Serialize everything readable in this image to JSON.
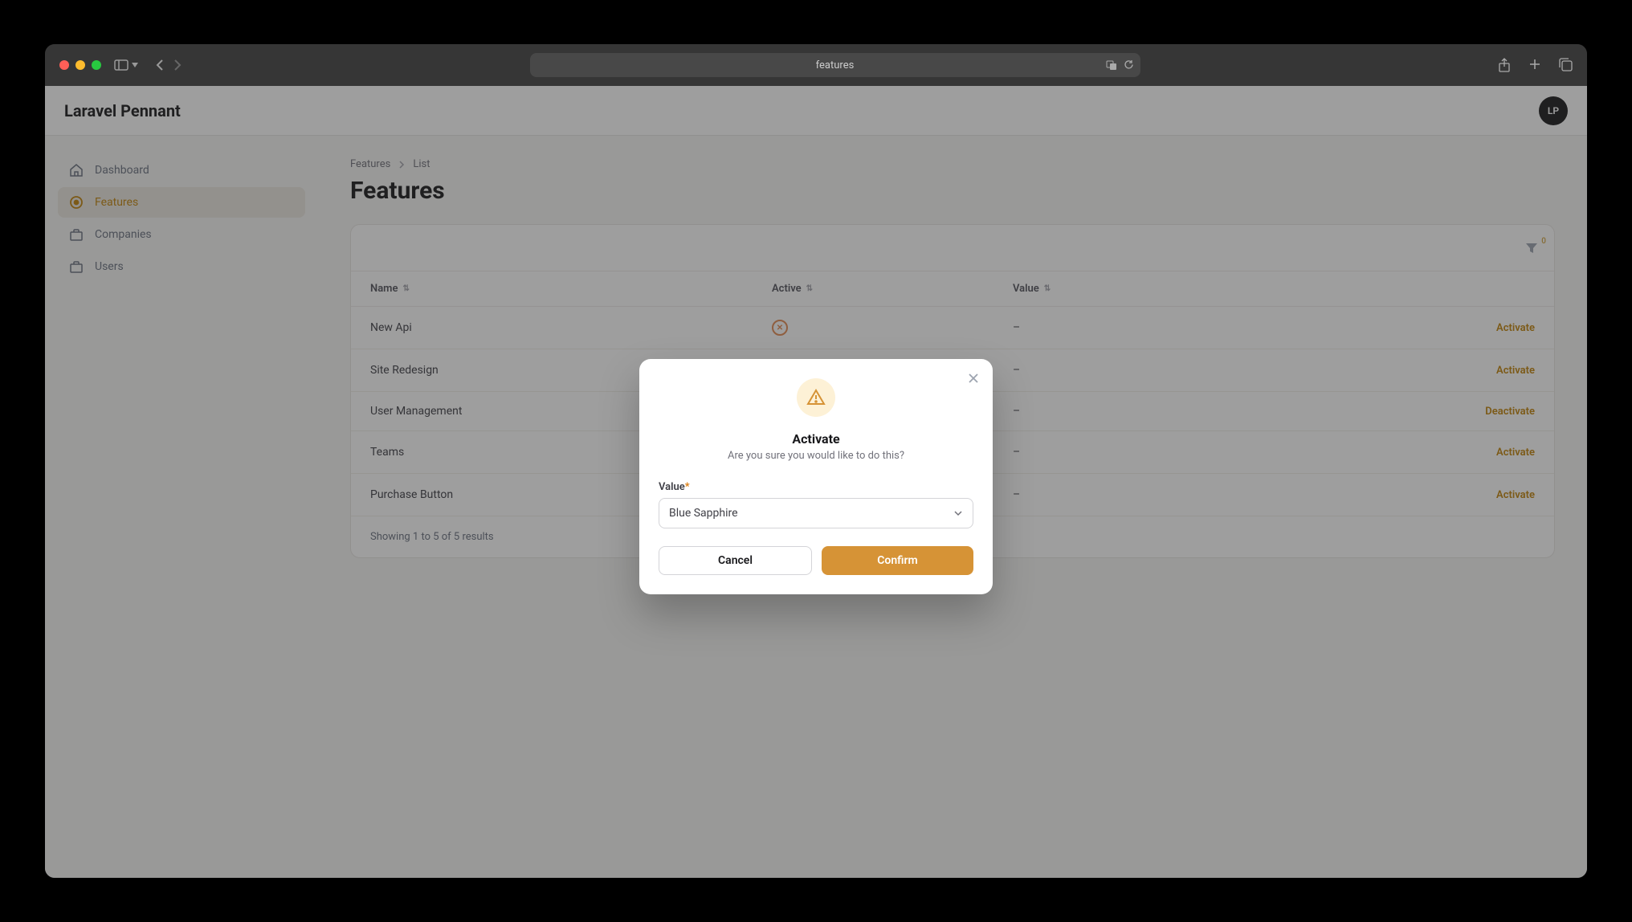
{
  "browser": {
    "addr_text": "features"
  },
  "app": {
    "title": "Laravel Pennant",
    "avatar_initials": "LP"
  },
  "sidebar": {
    "items": [
      {
        "label": "Dashboard"
      },
      {
        "label": "Features"
      },
      {
        "label": "Companies"
      },
      {
        "label": "Users"
      }
    ]
  },
  "breadcrumb": {
    "root": "Features",
    "current": "List"
  },
  "page": {
    "title": "Features"
  },
  "filter": {
    "count": "0"
  },
  "table": {
    "headers": {
      "name": "Name",
      "active": "Active",
      "value": "Value"
    },
    "rows": [
      {
        "name": "New Api",
        "active": false,
        "value": "–",
        "action": "Activate"
      },
      {
        "name": "Site Redesign",
        "active": false,
        "value": "–",
        "action": "Activate"
      },
      {
        "name": "User Management",
        "active": true,
        "value": "–",
        "action": "Deactivate"
      },
      {
        "name": "Teams",
        "active": false,
        "value": "–",
        "action": "Activate"
      },
      {
        "name": "Purchase Button",
        "active": false,
        "value": "–",
        "action": "Activate"
      }
    ],
    "footer": "Showing 1 to 5 of 5 results"
  },
  "modal": {
    "title": "Activate",
    "subtitle": "Are you sure you would like to do this?",
    "field_label": "Value",
    "field_required": "*",
    "select_value": "Blue Sapphire",
    "cancel": "Cancel",
    "confirm": "Confirm"
  }
}
